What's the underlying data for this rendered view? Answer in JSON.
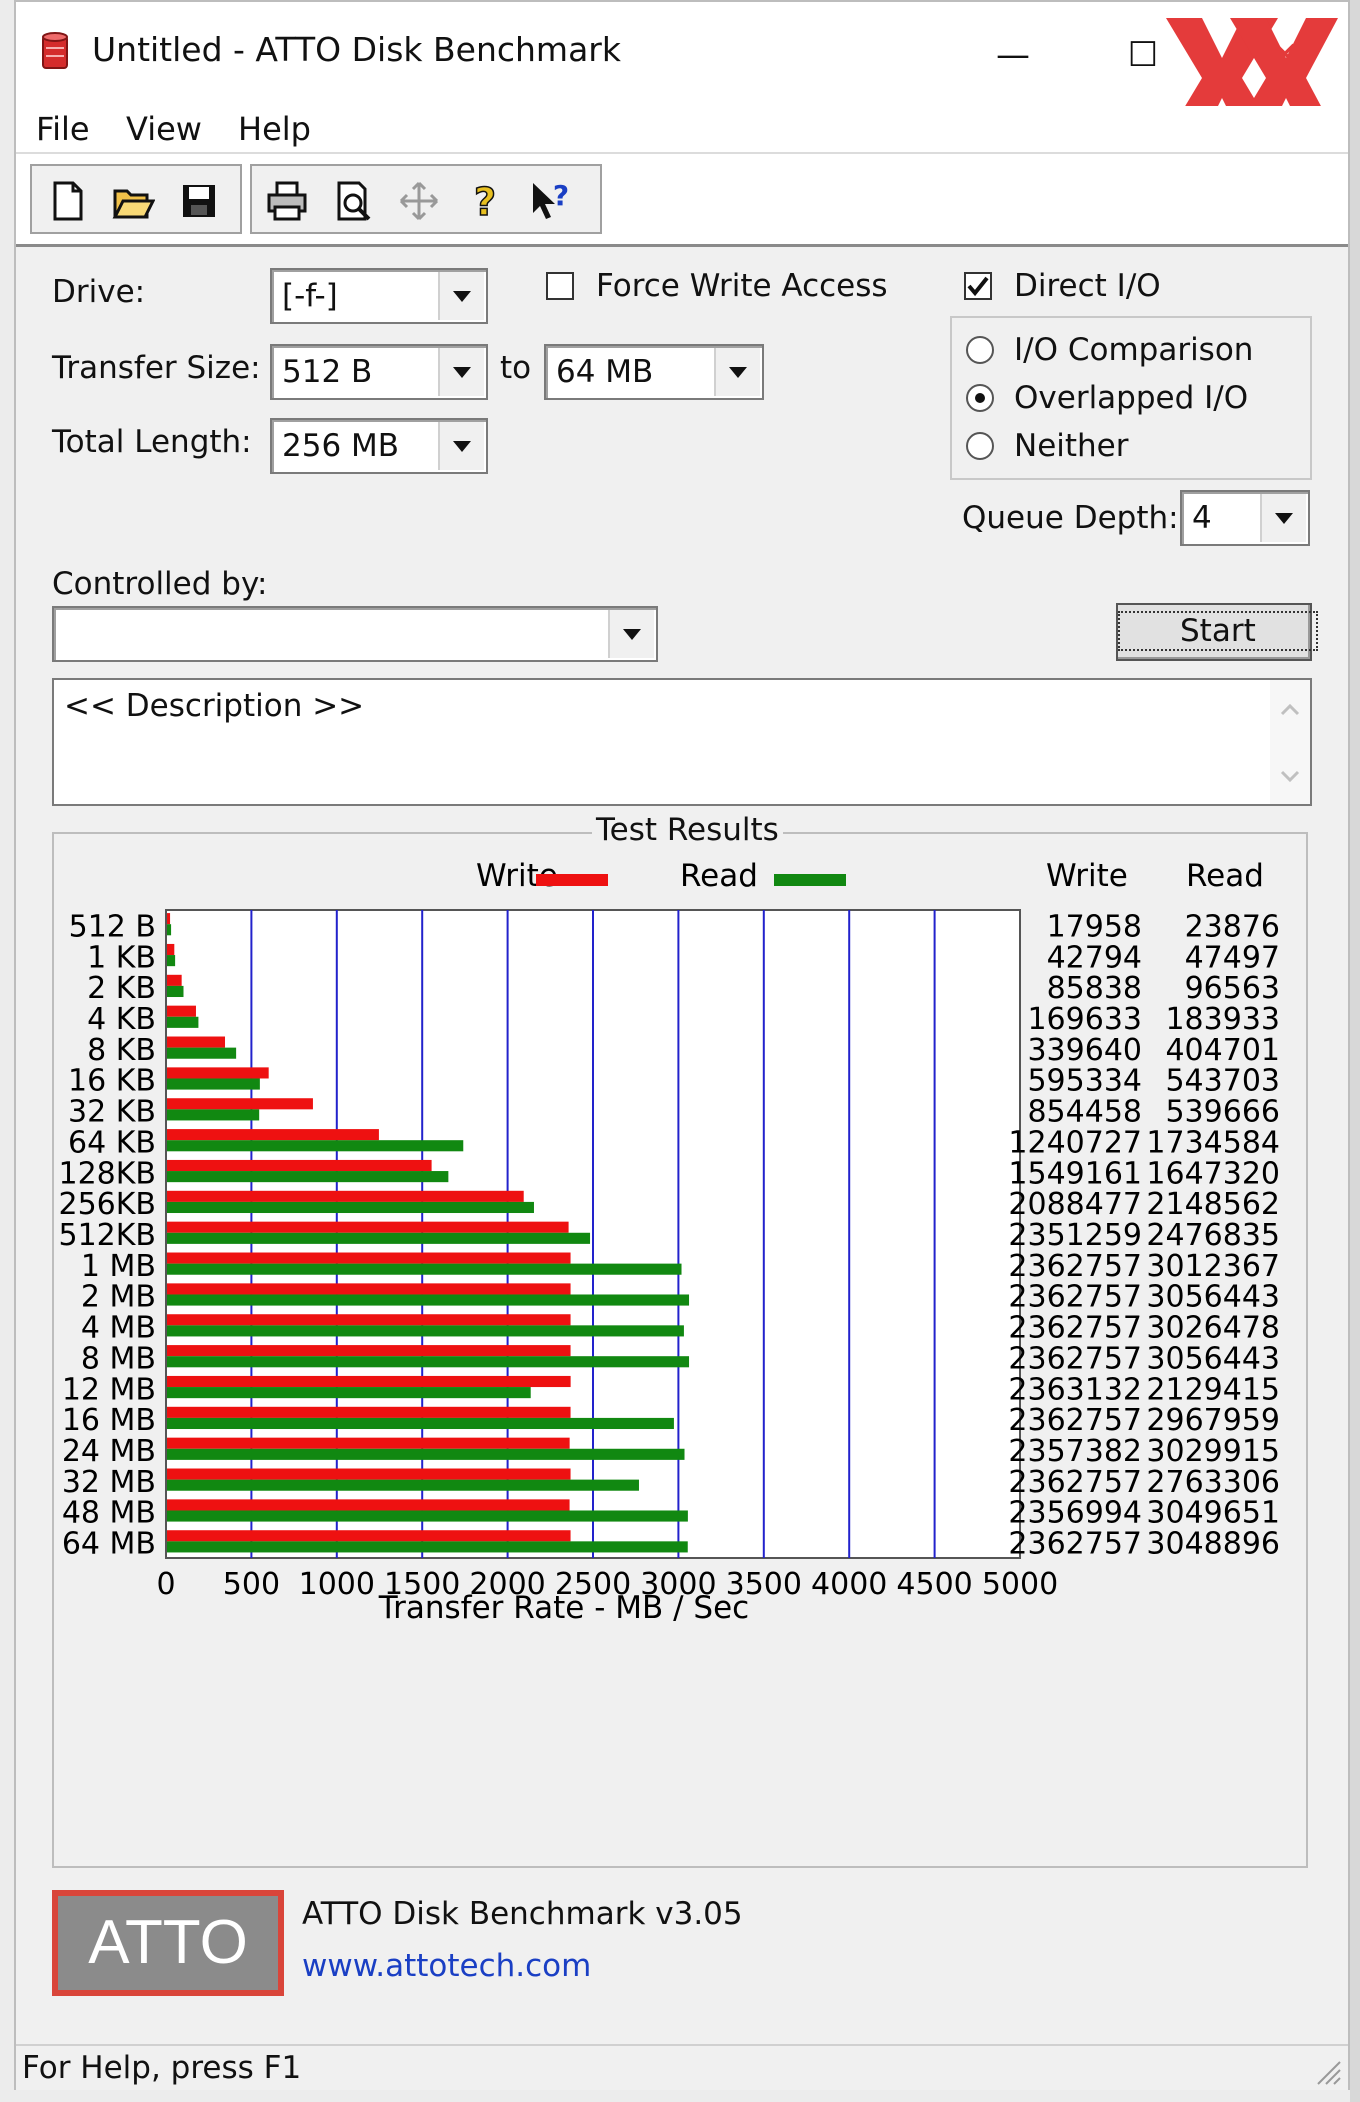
{
  "window": {
    "title": "Untitled - ATTO Disk Benchmark",
    "minimize": "—",
    "maximize": "☐",
    "close": "✕",
    "corner_logo_colors": [
      "#e43b3b"
    ]
  },
  "menu": [
    "File",
    "View",
    "Help"
  ],
  "toolbar": {
    "buttons": [
      "new-icon",
      "open-icon",
      "save-icon",
      "print-icon",
      "print-preview-icon",
      "move-icon",
      "help-icon",
      "context-help-icon"
    ]
  },
  "settings": {
    "drive_label": "Drive:",
    "drive_value": "[-f-]",
    "transfer_size_label": "Transfer Size:",
    "transfer_from": "512 B",
    "to_label": "to",
    "transfer_to": "64 MB",
    "total_length_label": "Total Length:",
    "total_length_value": "256 MB",
    "force_write_label": "Force Write Access",
    "force_write_checked": false,
    "direct_io_label": "Direct I/O",
    "direct_io_checked": true,
    "radio_options": [
      {
        "label": "I/O Comparison",
        "selected": false
      },
      {
        "label": "Overlapped I/O",
        "selected": true
      },
      {
        "label": "Neither",
        "selected": false
      }
    ],
    "queue_depth_label": "Queue Depth:",
    "queue_depth_value": "4",
    "controlled_by_label": "Controlled by:",
    "controlled_by_value": "",
    "start_label": "Start"
  },
  "description": "<< Description >>",
  "results": {
    "title": "Test Results",
    "legend_write": "Write",
    "legend_read": "Read",
    "col_write": "Write",
    "col_read": "Read",
    "write_color": "#ee1111",
    "read_color": "#118811",
    "grid_color": "#2222cc"
  },
  "chart_data": {
    "type": "bar",
    "orientation": "horizontal",
    "xlabel": "Transfer Rate - MB / Sec",
    "xlim": [
      0,
      5000
    ],
    "xticks": [
      0,
      500,
      1000,
      1500,
      2000,
      2500,
      3000,
      3500,
      4000,
      4500,
      5000
    ],
    "categories": [
      "512 B",
      "1 KB",
      "2 KB",
      "4 KB",
      "8 KB",
      "16 KB",
      "32 KB",
      "64 KB",
      "128KB",
      "256KB",
      "512KB",
      "1 MB",
      "2 MB",
      "4 MB",
      "8 MB",
      "12 MB",
      "16 MB",
      "24 MB",
      "32 MB",
      "48 MB",
      "64 MB"
    ],
    "series": [
      {
        "name": "Write",
        "values": [
          17958,
          42794,
          85838,
          169633,
          339640,
          595334,
          854458,
          1240727,
          1549161,
          2088477,
          2351259,
          2362757,
          2362757,
          2362757,
          2362757,
          2363132,
          2362757,
          2357382,
          2362757,
          2356994,
          2362757
        ]
      },
      {
        "name": "Read",
        "values": [
          23876,
          47497,
          96563,
          183933,
          404701,
          543703,
          539666,
          1734584,
          1647320,
          2148562,
          2476835,
          3012367,
          3056443,
          3026478,
          3056443,
          2129415,
          2967959,
          3029915,
          2763306,
          3049651,
          3048896
        ]
      }
    ]
  },
  "footer": {
    "logo_text": "ATTO",
    "version": "ATTO Disk Benchmark v3.05",
    "link": "www.attotech.com"
  },
  "status": "For Help, press F1"
}
